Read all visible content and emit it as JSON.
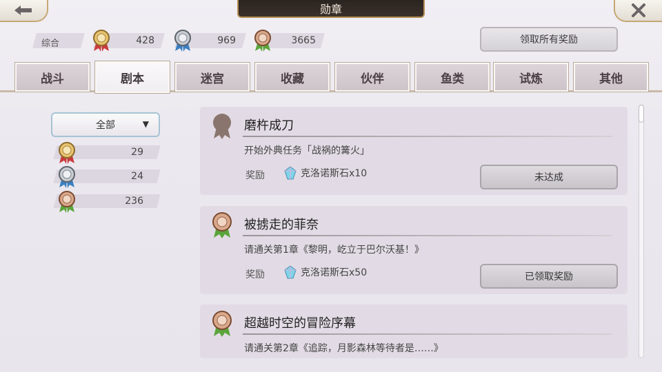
{
  "header": {
    "title": "勋章",
    "back_icon": "back-arrow-icon",
    "close_icon": "close-x-icon"
  },
  "summary": {
    "label": "综合",
    "gold_count": "428",
    "silver_count": "969",
    "bronze_count": "3665",
    "claim_all_label": "领取所有奖励"
  },
  "tabs": [
    {
      "label": "战斗"
    },
    {
      "label": "剧本"
    },
    {
      "label": "迷宫"
    },
    {
      "label": "收藏"
    },
    {
      "label": "伙伴"
    },
    {
      "label": "鱼类"
    },
    {
      "label": "试炼"
    },
    {
      "label": "其他"
    }
  ],
  "active_tab": "剧本",
  "filter": {
    "selected": "全部",
    "gold_count": "29",
    "silver_count": "24",
    "bronze_count": "236"
  },
  "medals": [
    {
      "title": "磨杵成刀",
      "description": "开始外典任务「战祸的篝火」",
      "reward_label": "奖励",
      "reward": "克洛诺斯石x10",
      "status": "未达成",
      "achieved": false
    },
    {
      "title": "被掳走的菲奈",
      "description": "请通关第1章《黎明，屹立于巴尔沃基！》",
      "reward_label": "奖励",
      "reward": "克洛诺斯石x50",
      "status": "已领取奖励",
      "achieved": true
    },
    {
      "title": "超越时空的冒险序幕",
      "description": "请通关第2章《追踪，月影森林等待者是……》",
      "achieved": true
    }
  ],
  "colors": {
    "gold_ribbon": "#c93b3b",
    "silver_ribbon": "#3a7fc1",
    "bronze_ribbon": "#5aa53a",
    "accent_border": "#c6a774"
  }
}
